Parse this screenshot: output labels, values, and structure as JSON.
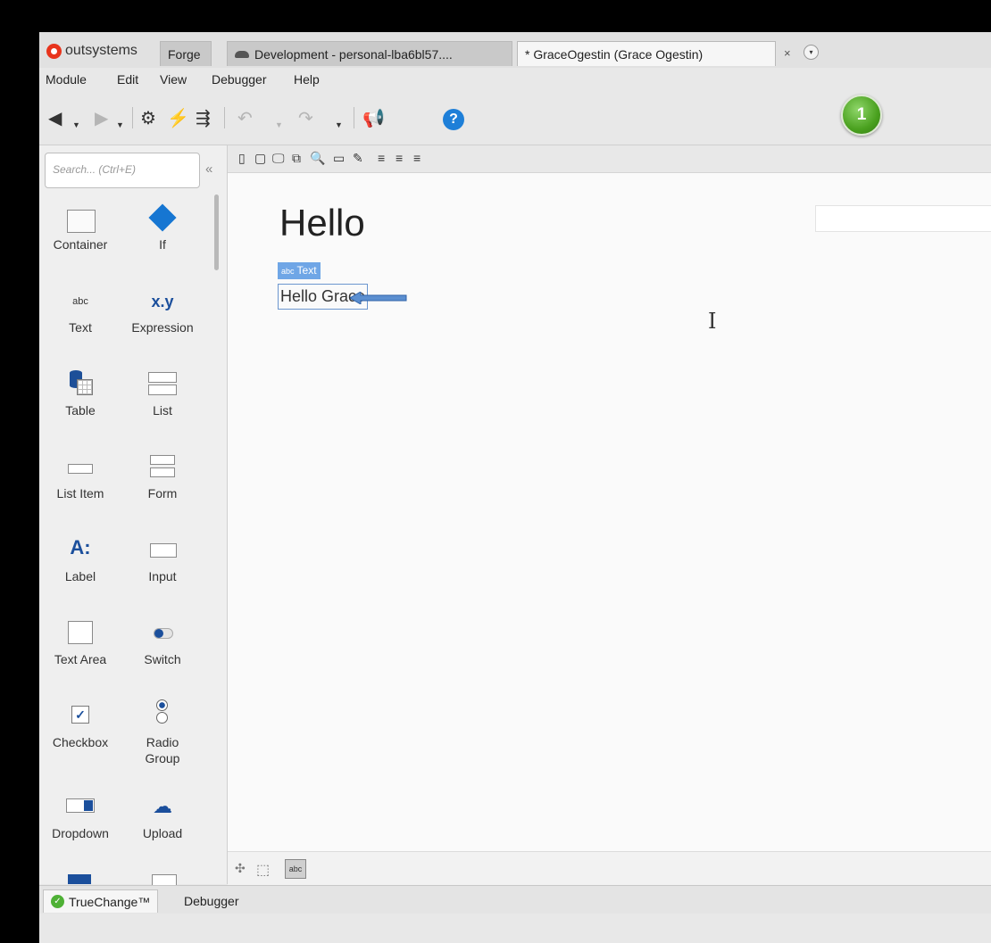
{
  "tabs": {
    "brand": "outsystems",
    "forge": "Forge",
    "development": "Development - personal-lba6bl57....",
    "active": "* GraceOgestin (Grace Ogestin)",
    "close": "×",
    "more": "▾"
  },
  "menu": [
    "Module",
    "Edit",
    "View",
    "Debugger",
    "Help"
  ],
  "toolbar": {
    "notification_count": "1",
    "help": "?"
  },
  "search": {
    "placeholder": "Search... (Ctrl+E)",
    "value": ""
  },
  "widgets": {
    "container": "Container",
    "if": "If",
    "text": "Text",
    "text_icon": "abc",
    "expression": "Expression",
    "expression_icon": "x.y",
    "table": "Table",
    "list": "List",
    "list_item": "List Item",
    "form": "Form",
    "label": "Label",
    "label_icon": "A:",
    "input": "Input",
    "text_area": "Text Area",
    "switch": "Switch",
    "checkbox": "Checkbox",
    "radio_group": "Radio Group",
    "dropdown": "Dropdown",
    "upload": "Upload"
  },
  "canvas": {
    "title": "Hello",
    "tag_icon": "abc",
    "tag_label": "Text",
    "selected_text": "Hello Grace"
  },
  "canvas_bottom": {
    "abc": "abc"
  },
  "bottom_tabs": {
    "truechange": "TrueChange™",
    "debugger": "Debugger"
  },
  "colors": {
    "accent": "#1676d2",
    "brand": "#e8341c",
    "badge": "#4aa11f",
    "selection": "#6fa6e6"
  }
}
